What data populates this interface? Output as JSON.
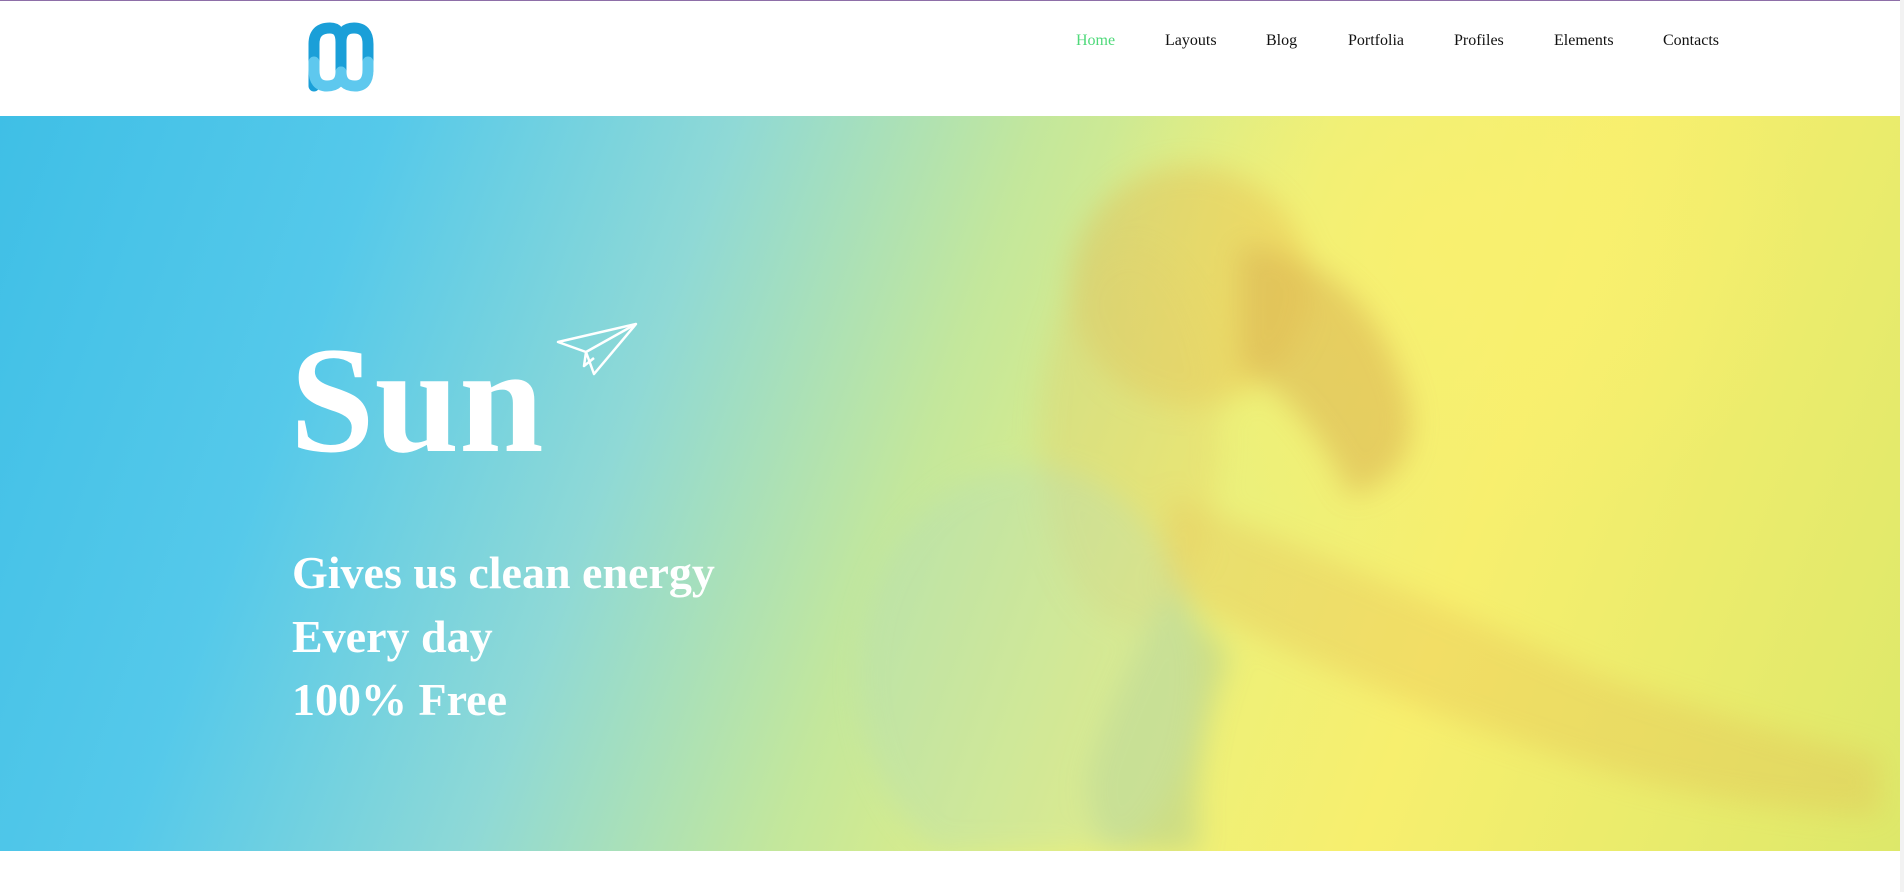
{
  "header": {
    "logo_icon": "mw-logo-icon",
    "nav": [
      {
        "label": "Home",
        "active": true
      },
      {
        "label": "Layouts",
        "active": false
      },
      {
        "label": "Blog",
        "active": false
      },
      {
        "label": "Portfolia",
        "active": false
      },
      {
        "label": "Profiles",
        "active": false
      },
      {
        "label": "Elements",
        "active": false
      },
      {
        "label": "Contacts",
        "active": false
      }
    ]
  },
  "hero": {
    "title": "Sun",
    "icon": "paper-plane-icon",
    "lines": [
      "Gives us clean energy",
      "Every day",
      "100% Free"
    ]
  },
  "colors": {
    "nav_active": "#4fd97a",
    "logo_dark": "#1a9fd8",
    "logo_light": "#5ec8ee",
    "hero_blue": "#3fbfe6",
    "hero_yellow": "#f7ef6e"
  }
}
